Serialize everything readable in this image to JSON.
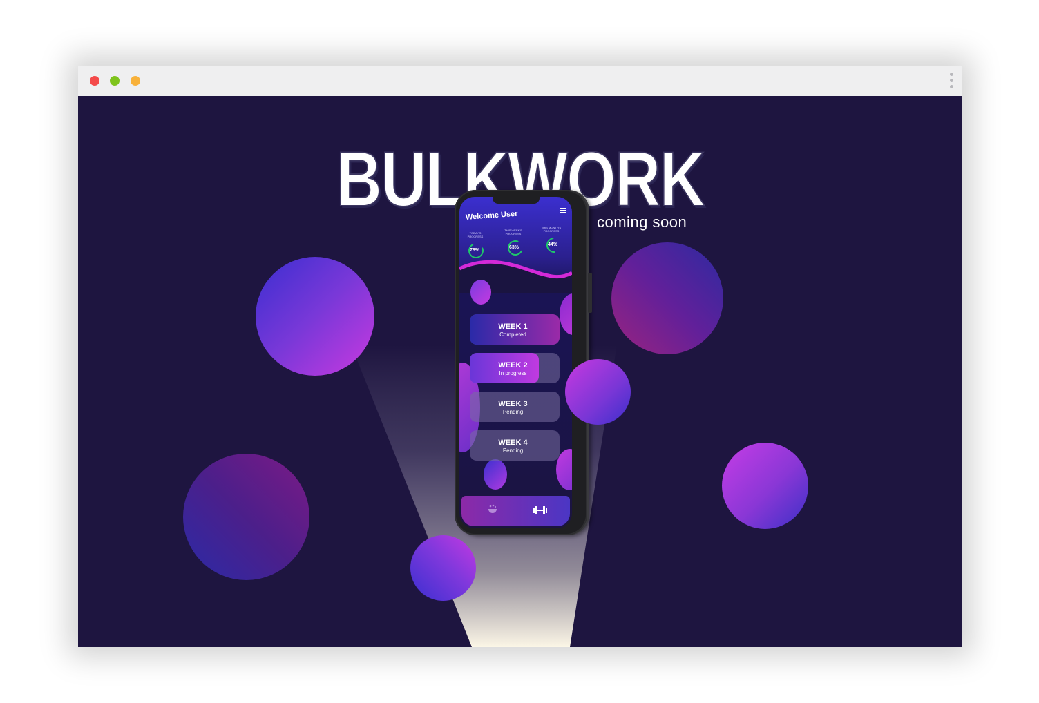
{
  "window": {
    "controls": [
      "close",
      "minimize",
      "maximize"
    ],
    "menu_icon": "kebab-menu-icon"
  },
  "page": {
    "title": "BULKWORK",
    "subtitle": "coming soon",
    "background_color": "#1e1540"
  },
  "phone": {
    "welcome": "Welcome User",
    "menu_icon": "hamburger-icon",
    "stats": [
      {
        "label": "TODAY'S PROGRESS",
        "value": "78%",
        "fraction": 0.78
      },
      {
        "label": "THIS WEEK'S PROGRESS",
        "value": "63%",
        "fraction": 0.63
      },
      {
        "label": "THIS MONTH'S PROGRESS",
        "value": "44%",
        "fraction": 0.44
      }
    ],
    "weeks": [
      {
        "title": "WEEK 1",
        "status": "Completed",
        "progress": 1.0
      },
      {
        "title": "WEEK 2",
        "status": "In progress",
        "progress": 0.77
      },
      {
        "title": "WEEK 3",
        "status": "Pending",
        "progress": 0.0
      },
      {
        "title": "WEEK 4",
        "status": "Pending",
        "progress": 0.0
      }
    ],
    "tabbar_icons": [
      "food-bowl-icon",
      "dumbbell-icon"
    ],
    "progress_ring_color": "#1fc76a",
    "accent_color": "#c02fd8"
  }
}
